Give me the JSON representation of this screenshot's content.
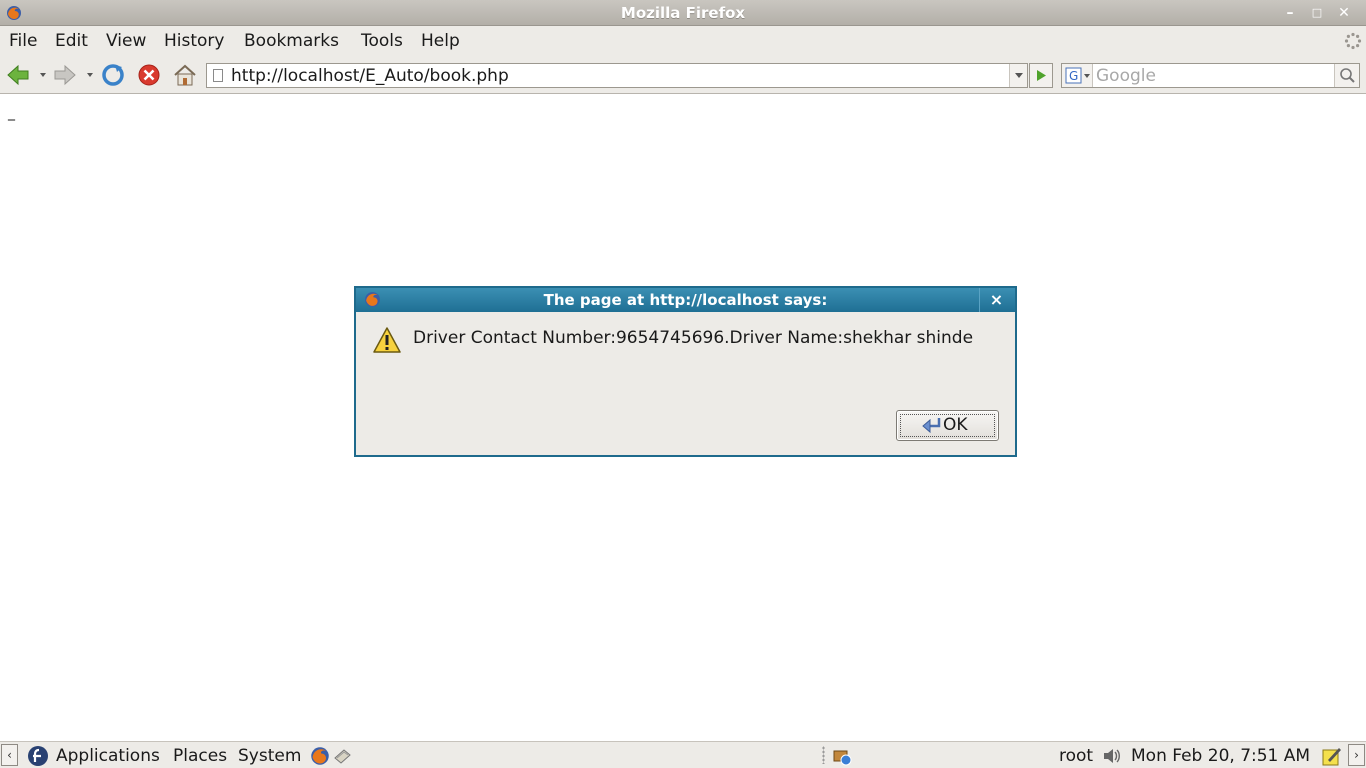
{
  "window": {
    "title": "Mozilla Firefox"
  },
  "menubar": {
    "items": [
      "File",
      "Edit",
      "View",
      "History",
      "Bookmarks",
      "Tools",
      "Help"
    ]
  },
  "navbar": {
    "url": "http://localhost/E_Auto/book.php",
    "search_placeholder": "Google"
  },
  "content": {
    "mark": "_"
  },
  "dialog": {
    "title": "The page at http://localhost says:",
    "message": "Driver Contact Number:9654745696.Driver Name:shekhar shinde",
    "ok_label": "OK",
    "close_label": "×"
  },
  "panel": {
    "applications": "Applications",
    "places": "Places",
    "system": "System",
    "user": "root",
    "clock": "Mon Feb 20,  7:51 AM"
  },
  "colors": {
    "dialog_title_bg": "#1f6f94",
    "chrome_bg": "#edebe7",
    "titlebar_bg": "#b3afa8"
  }
}
